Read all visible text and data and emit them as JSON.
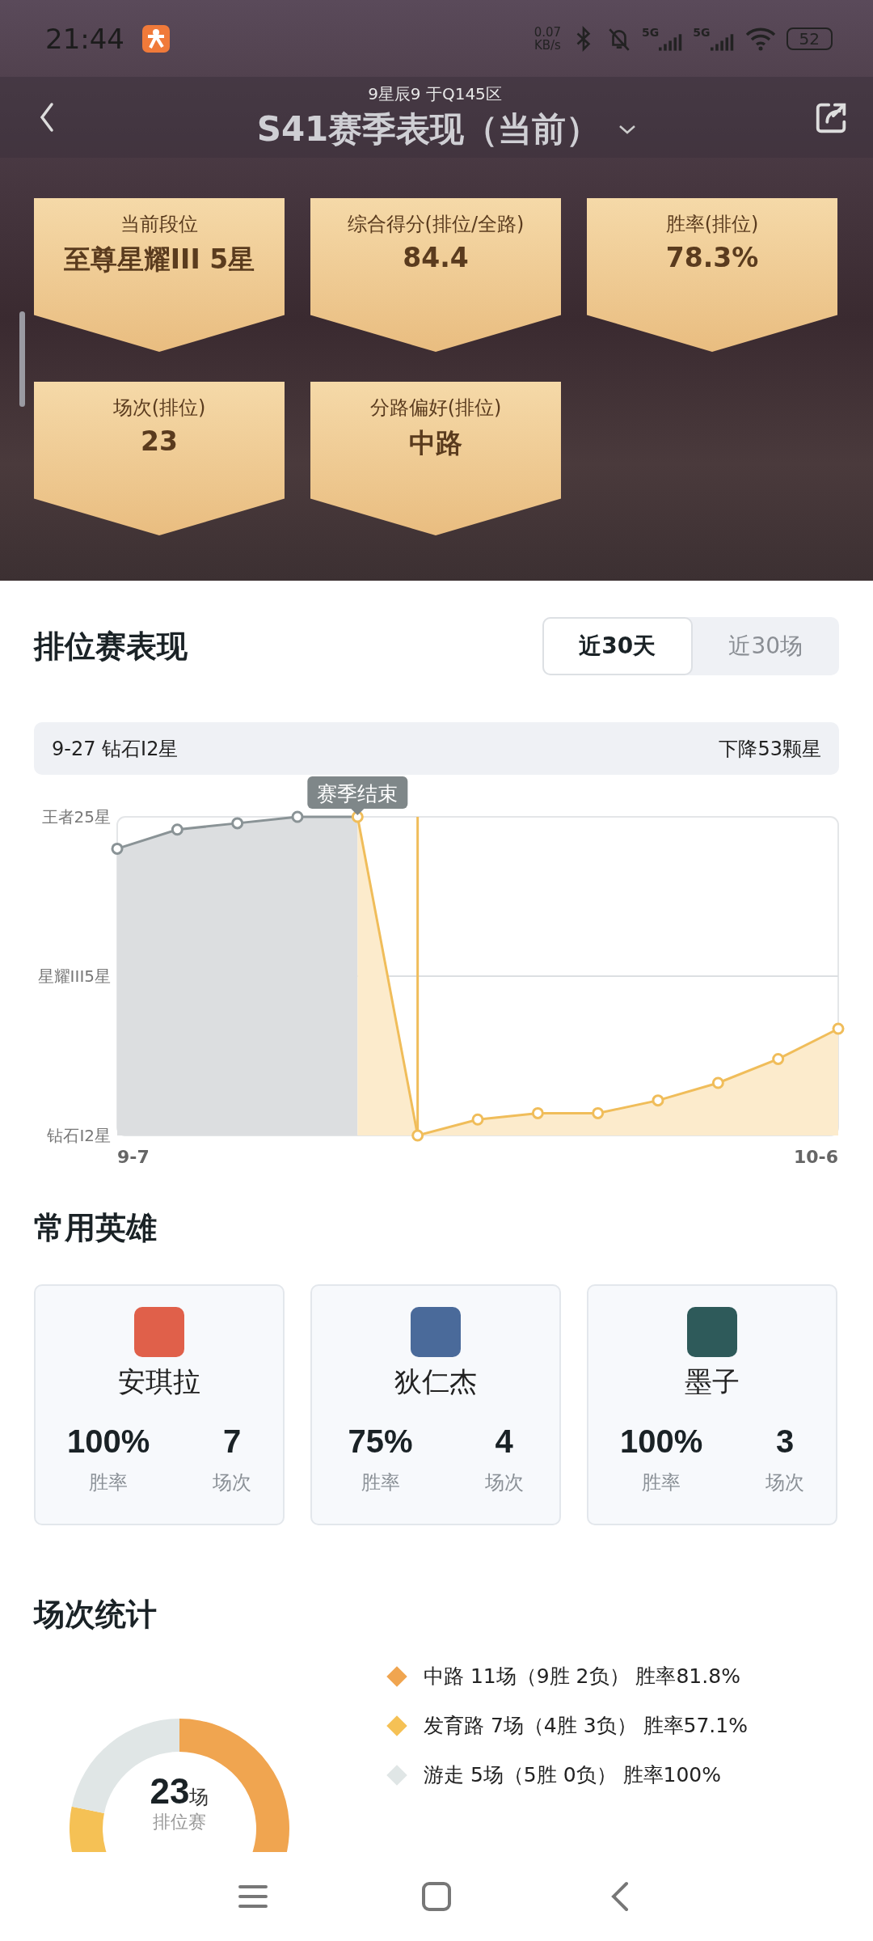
{
  "status_bar": {
    "time": "21:44",
    "speed_value": "0.07",
    "speed_unit": "KB/s",
    "signal_labels": [
      "5G",
      "5G"
    ],
    "battery": "52"
  },
  "header": {
    "subtitle": "9星辰9 于Q145区",
    "title": "S41赛季表现（当前）"
  },
  "summary": [
    {
      "label": "当前段位",
      "value": "至尊星耀III 5星"
    },
    {
      "label": "综合得分(排位/全路)",
      "value": "84.4"
    },
    {
      "label": "胜率(排位)",
      "value": "78.3%"
    },
    {
      "label": "场次(排位)",
      "value": "23"
    },
    {
      "label": "分路偏好(排位)",
      "value": "中路"
    }
  ],
  "ranked": {
    "title": "排位赛表现",
    "tabs": [
      {
        "label": "近30天",
        "selected": true
      },
      {
        "label": "近30场",
        "selected": false
      }
    ],
    "info": {
      "left": "9-27 钻石I2星",
      "right": "下降53颗星"
    },
    "y_axis_labels": [
      "王者25星",
      "星耀III5星",
      "钻石I2星"
    ],
    "x_axis_labels": [
      "9-7",
      "10-6"
    ],
    "callout": "赛季结束"
  },
  "heroes": {
    "title": "常用英雄",
    "items": [
      {
        "name": "安琪拉",
        "win_rate": "100%",
        "win_label": "胜率",
        "games": "7",
        "games_label": "场次",
        "color": "#e0604a"
      },
      {
        "name": "狄仁杰",
        "win_rate": "75%",
        "win_label": "胜率",
        "games": "4",
        "games_label": "场次",
        "color": "#4a6a9a"
      },
      {
        "name": "墨子",
        "win_rate": "100%",
        "win_label": "胜率",
        "games": "3",
        "games_label": "场次",
        "color": "#2e5a5a"
      }
    ]
  },
  "stats": {
    "title": "场次统计",
    "total": "23",
    "total_unit": "场",
    "total_label": "排位赛",
    "chart_data": {
      "type": "donut",
      "values": [
        47.8,
        30.4,
        21.8
      ]
    },
    "legend": [
      {
        "text": "中路 11场（9胜 2负） 胜率81.8%",
        "color": "#f0a550"
      },
      {
        "text": "发育路 7场（4胜 3负） 胜率57.1%",
        "color": "#f5c155"
      },
      {
        "text": "游走 5场（5胜 0负） 胜率100%",
        "color": "#e0e6e6"
      }
    ]
  }
}
